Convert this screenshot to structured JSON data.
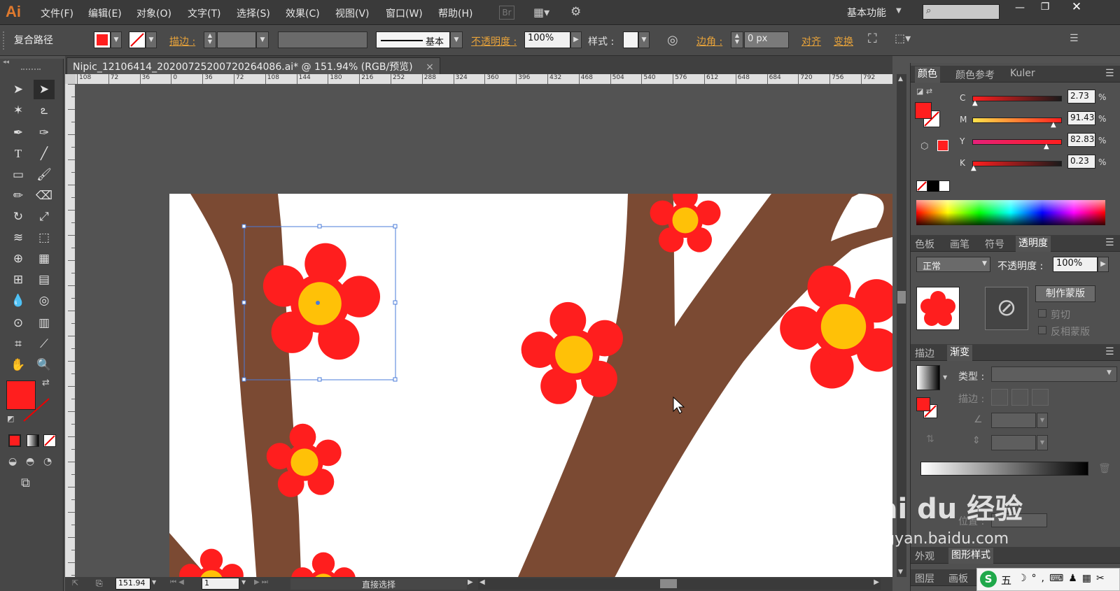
{
  "app": {
    "logo": "Ai"
  },
  "menu": [
    "文件(F)",
    "编辑(E)",
    "对象(O)",
    "文字(T)",
    "选择(S)",
    "效果(C)",
    "视图(V)",
    "窗口(W)",
    "帮助(H)"
  ],
  "menubar_right": {
    "br_label": "Br",
    "workspace": "基本功能",
    "search_placeholder": ""
  },
  "control": {
    "object_type": "复合路径",
    "stroke_label": "描边 :",
    "stroke_style_label": "基本",
    "opacity_label": "不透明度 :",
    "opacity_value": "100%",
    "style_label": "样式 :",
    "corner_label": "边角 :",
    "corner_value": "0 px",
    "align_label": "对齐",
    "transform_label": "变换",
    "fill_color": "#ff1e1e"
  },
  "document": {
    "tab_title": "Nipic_12106414_20200725200720264086.ai* @ 151.94% (RGB/预览)",
    "close_glyph": "×"
  },
  "ruler": {
    "h_ticks": [
      "108",
      "72",
      "36",
      "0",
      "36",
      "72",
      "108",
      "144",
      "180",
      "216",
      "252",
      "288",
      "324",
      "360",
      "396",
      "432",
      "468",
      "504",
      "540",
      "576",
      "612",
      "648",
      "684",
      "720",
      "756",
      "792"
    ]
  },
  "status": {
    "zoom": "151.94",
    "artboard": "1",
    "tool": "直接选择"
  },
  "color_panel": {
    "tabs": [
      "颜色",
      "颜色参考",
      "Kuler"
    ],
    "channels": [
      {
        "label": "C",
        "value": "2.73",
        "unit": "%"
      },
      {
        "label": "M",
        "value": "91.43",
        "unit": "%"
      },
      {
        "label": "Y",
        "value": "82.83",
        "unit": "%"
      },
      {
        "label": "K",
        "value": "0.23",
        "unit": "%"
      }
    ]
  },
  "transparency_panel": {
    "tabs": [
      "色板",
      "画笔",
      "符号",
      "透明度"
    ],
    "blend_mode": "正常",
    "opacity_label": "不透明度 :",
    "opacity_value": "100%",
    "make_mask": "制作蒙版",
    "clip": "剪切",
    "invert_mask": "反相蒙版"
  },
  "gradient_panel": {
    "tabs": [
      "描边",
      "渐变"
    ],
    "type_label": "类型 :",
    "stroke_label": "描边 :",
    "position_label": "位置 :"
  },
  "bottom_panels": {
    "row1": [
      "外观",
      "图形样式"
    ],
    "row2": [
      "图层",
      "画板"
    ]
  },
  "watermark": {
    "brand": "Bai du 经验",
    "url": "jingyan.baidu.com"
  },
  "ime": {
    "label": "五"
  },
  "colors": {
    "flower": "#ff1e1e",
    "center": "#ffc107",
    "branch": "#7b4a33",
    "selection": "#4a7bd8",
    "accent": "#e8a33a"
  }
}
